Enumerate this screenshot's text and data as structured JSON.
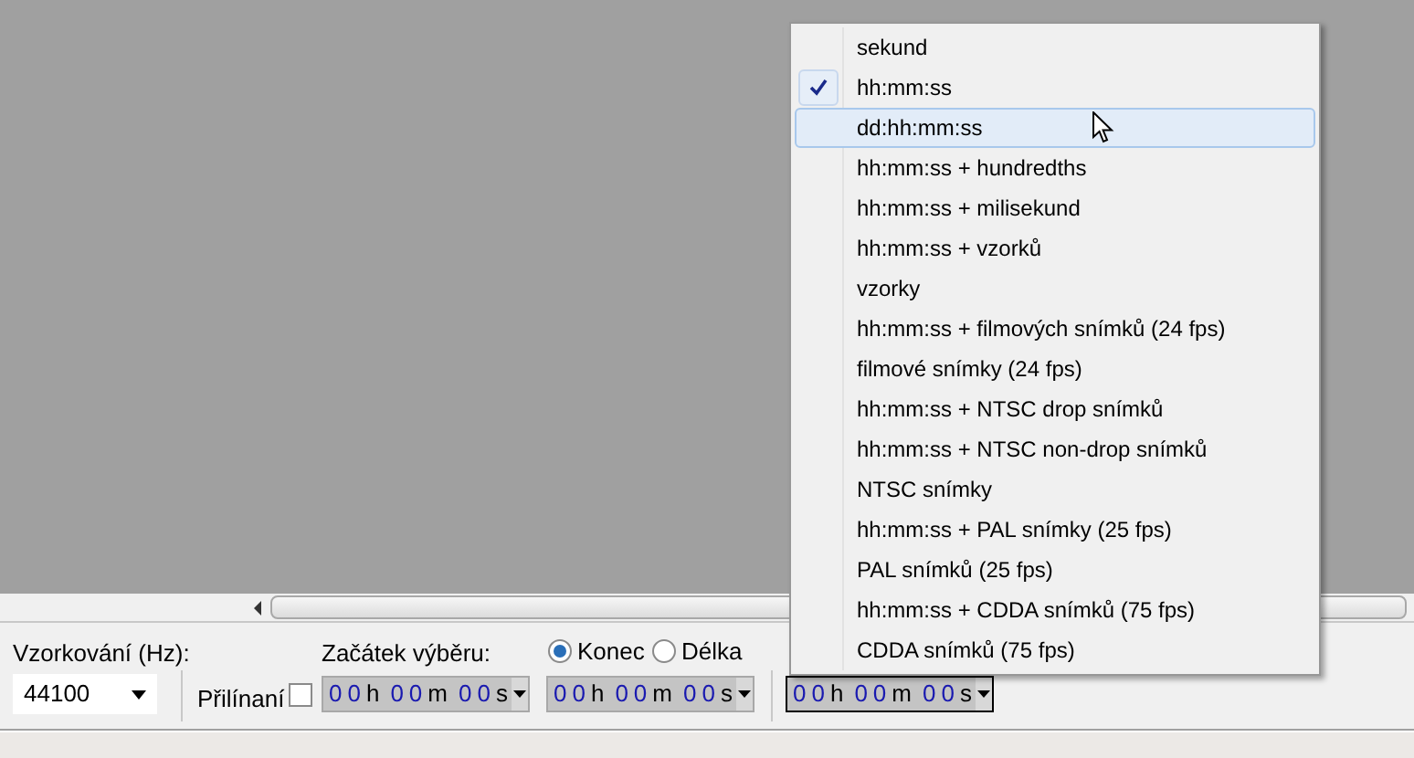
{
  "toolbar": {
    "rate_label": "Vzorkování (Hz):",
    "rate_value": "44100",
    "snap_label": "Přilínaní",
    "snap_checked": false,
    "start_label": "Začátek výběru:",
    "end_options": [
      {
        "label": "Konec",
        "selected": true
      },
      {
        "label": "Délka",
        "selected": false
      }
    ],
    "time_fields": [
      {
        "hours": "00",
        "minutes": "00",
        "seconds": "00",
        "h": "h",
        "m": "m",
        "s": "s",
        "focused": false
      },
      {
        "hours": "00",
        "minutes": "00",
        "seconds": "00",
        "h": "h",
        "m": "m",
        "s": "s",
        "focused": false
      },
      {
        "hours": "00",
        "minutes": "00",
        "seconds": "00",
        "h": "h",
        "m": "m",
        "s": "s",
        "focused": true
      }
    ]
  },
  "menu": {
    "items": [
      {
        "label": "sekund",
        "checked": false,
        "selected": false
      },
      {
        "label": "hh:mm:ss",
        "checked": true,
        "selected": false
      },
      {
        "label": "dd:hh:mm:ss",
        "checked": false,
        "selected": true
      },
      {
        "label": "hh:mm:ss + hundredths",
        "checked": false,
        "selected": false
      },
      {
        "label": "hh:mm:ss + milisekund",
        "checked": false,
        "selected": false
      },
      {
        "label": "hh:mm:ss + vzorků",
        "checked": false,
        "selected": false
      },
      {
        "label": "vzorky",
        "checked": false,
        "selected": false
      },
      {
        "label": "hh:mm:ss + filmových snímků (24 fps)",
        "checked": false,
        "selected": false
      },
      {
        "label": "filmové snímky (24 fps)",
        "checked": false,
        "selected": false
      },
      {
        "label": "hh:mm:ss + NTSC drop snímků",
        "checked": false,
        "selected": false
      },
      {
        "label": "hh:mm:ss + NTSC non-drop snímků",
        "checked": false,
        "selected": false
      },
      {
        "label": "NTSC snímky",
        "checked": false,
        "selected": false
      },
      {
        "label": "hh:mm:ss + PAL snímky (25 fps)",
        "checked": false,
        "selected": false
      },
      {
        "label": "PAL snímků (25 fps)",
        "checked": false,
        "selected": false
      },
      {
        "label": "hh:mm:ss + CDDA snímků (75 fps)",
        "checked": false,
        "selected": false
      },
      {
        "label": "CDDA snímků (75 fps)",
        "checked": false,
        "selected": false
      }
    ]
  }
}
